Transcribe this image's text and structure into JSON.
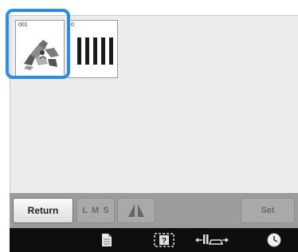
{
  "patterns": [
    {
      "number": "001",
      "selected": true
    },
    {
      "number": "0",
      "selected": false
    }
  ],
  "toolbar": {
    "return_label": "Return",
    "size_label": "L M S",
    "set_label": "Set"
  },
  "colors": {
    "selection": "#2a8ee8",
    "screen_bg": "#ececec",
    "toolbar_bg": "#9c9c9c",
    "statusbar_bg": "#0e0e0e"
  },
  "icons": [
    "page-icon",
    "frame-help-icon",
    "presser-foot-icon",
    "clock-icon"
  ]
}
